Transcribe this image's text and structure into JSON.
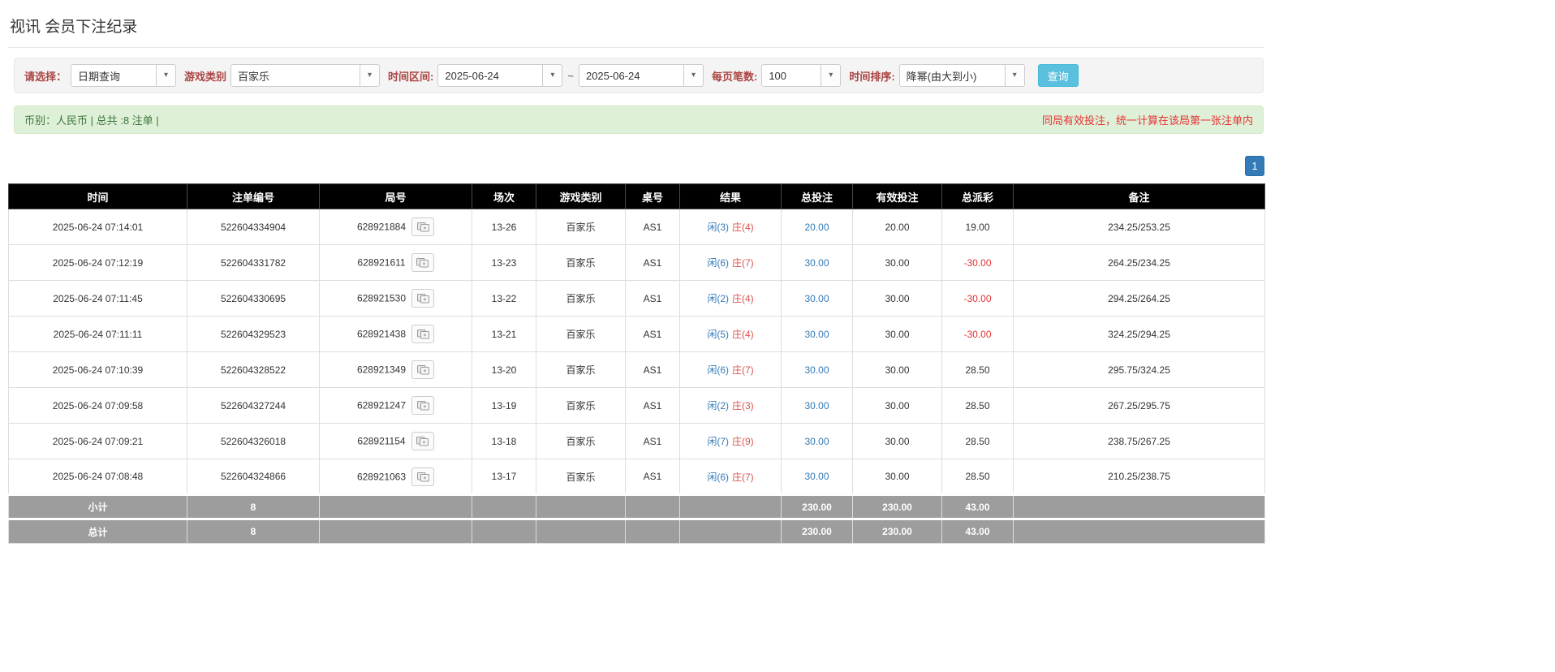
{
  "colors": {
    "accent-blue": "#337ab7",
    "link-blue": "#337ab7",
    "player-blue": "#337ab7",
    "banker-red": "#d9534f",
    "danger-red": "#e53333",
    "negative-red": "#e53333",
    "label-red": "#a94442",
    "success-bg": "#dff0d8",
    "success-border": "#d6e9c6",
    "header-bg": "#000000",
    "footer-bg": "#9d9d9d",
    "search-btn-bg": "#5bc0de"
  },
  "page": {
    "title": "视讯 会员下注纪录"
  },
  "filters": {
    "select_label": "请选择：",
    "select_value": "日期查询",
    "game_type_label": "游戏类别",
    "game_type_value": "百家乐",
    "time_range_label": "时间区间:",
    "date_from": "2025-06-24",
    "range_separator": "~",
    "date_to": "2025-06-24",
    "page_size_label": "每页笔数:",
    "page_size_value": "100",
    "sort_label": "时间排序:",
    "sort_value": "降幂(由大到小)",
    "search_button_label": "查询",
    "dropdown_caret": "▾"
  },
  "summary": {
    "left_text": "币别：人民币 | 总共 :8 注单 |",
    "right_text": "同局有效投注，统一计算在该局第一张注单内"
  },
  "pagination": {
    "current_page": "1"
  },
  "table": {
    "headers": [
      "时间",
      "注单编号",
      "局号",
      "场次",
      "游戏类别",
      "桌号",
      "结果",
      "总投注",
      "有效投注",
      "总派彩",
      "备注"
    ],
    "rows": [
      {
        "time": "2025-06-24 07:14:01",
        "bet_id": "522604334904",
        "round_id": "628921884",
        "session": "13-26",
        "game": "百家乐",
        "table_no": "AS1",
        "result_player": "闲(3)",
        "result_banker": "庄(4)",
        "total_bet": "20.00",
        "valid_bet": "20.00",
        "payout": "19.00",
        "note": "234.25/253.25"
      },
      {
        "time": "2025-06-24 07:12:19",
        "bet_id": "522604331782",
        "round_id": "628921611",
        "session": "13-23",
        "game": "百家乐",
        "table_no": "AS1",
        "result_player": "闲(6)",
        "result_banker": "庄(7)",
        "total_bet": "30.00",
        "valid_bet": "30.00",
        "payout": "-30.00",
        "note": "264.25/234.25"
      },
      {
        "time": "2025-06-24 07:11:45",
        "bet_id": "522604330695",
        "round_id": "628921530",
        "session": "13-22",
        "game": "百家乐",
        "table_no": "AS1",
        "result_player": "闲(2)",
        "result_banker": "庄(4)",
        "total_bet": "30.00",
        "valid_bet": "30.00",
        "payout": "-30.00",
        "note": "294.25/264.25"
      },
      {
        "time": "2025-06-24 07:11:11",
        "bet_id": "522604329523",
        "round_id": "628921438",
        "session": "13-21",
        "game": "百家乐",
        "table_no": "AS1",
        "result_player": "闲(5)",
        "result_banker": "庄(4)",
        "total_bet": "30.00",
        "valid_bet": "30.00",
        "payout": "-30.00",
        "note": "324.25/294.25"
      },
      {
        "time": "2025-06-24 07:10:39",
        "bet_id": "522604328522",
        "round_id": "628921349",
        "session": "13-20",
        "game": "百家乐",
        "table_no": "AS1",
        "result_player": "闲(6)",
        "result_banker": "庄(7)",
        "total_bet": "30.00",
        "valid_bet": "30.00",
        "payout": "28.50",
        "note": "295.75/324.25"
      },
      {
        "time": "2025-06-24 07:09:58",
        "bet_id": "522604327244",
        "round_id": "628921247",
        "session": "13-19",
        "game": "百家乐",
        "table_no": "AS1",
        "result_player": "闲(2)",
        "result_banker": "庄(3)",
        "total_bet": "30.00",
        "valid_bet": "30.00",
        "payout": "28.50",
        "note": "267.25/295.75"
      },
      {
        "time": "2025-06-24 07:09:21",
        "bet_id": "522604326018",
        "round_id": "628921154",
        "session": "13-18",
        "game": "百家乐",
        "table_no": "AS1",
        "result_player": "闲(7)",
        "result_banker": "庄(9)",
        "total_bet": "30.00",
        "valid_bet": "30.00",
        "payout": "28.50",
        "note": "238.75/267.25"
      },
      {
        "time": "2025-06-24 07:08:48",
        "bet_id": "522604324866",
        "round_id": "628921063",
        "session": "13-17",
        "game": "百家乐",
        "table_no": "AS1",
        "result_player": "闲(6)",
        "result_banker": "庄(7)",
        "total_bet": "30.00",
        "valid_bet": "30.00",
        "payout": "28.50",
        "note": "210.25/238.75"
      }
    ],
    "subtotal": {
      "label": "小计",
      "count": "8",
      "total_bet": "230.00",
      "valid_bet": "230.00",
      "payout": "43.00"
    },
    "total": {
      "label": "总计",
      "count": "8",
      "total_bet": "230.00",
      "valid_bet": "230.00",
      "payout": "43.00"
    }
  }
}
